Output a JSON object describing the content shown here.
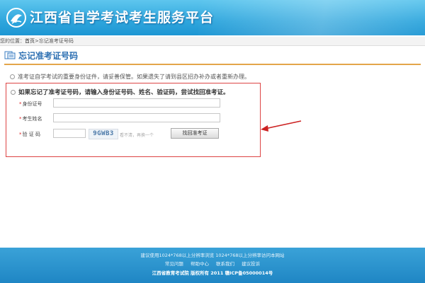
{
  "header": {
    "site_title": "江西省自学考试考生服务平台"
  },
  "breadcrumb": {
    "prefix": "您的位置：",
    "home": "首页",
    "separator": " > ",
    "current": "忘记准考证号码"
  },
  "page": {
    "title": "忘记准考证号码"
  },
  "notice": "准考证自学考试的重要身份证件，请妥善保管。如果遗失了请到县区招办补办或者重新办理。",
  "form": {
    "heading": "如果忘记了准考证号码，请输入身份证号码、姓名、验证码，尝试找回准考证。",
    "id_label": "身份证号",
    "name_label": "考生姓名",
    "captcha_label": "验 证 码",
    "id_value": "",
    "name_value": "",
    "captcha_value": "",
    "captcha_text": "9GWB3",
    "captcha_hint": "看不清，再换一个",
    "submit_label": "找回准考证"
  },
  "footer": {
    "line1": "建议使用1024*768以上分辨率浏览 1024*768以上分辨率访问本网站",
    "links": [
      "常见问题",
      "帮助中心",
      "联系我们",
      "建议投诉"
    ],
    "line3": "江西省教育考试院 版权所有 2011 赣ICP备05000014号"
  },
  "colors": {
    "header_blue": "#2fa6dd",
    "title_blue": "#2c6fb2",
    "rule_orange": "#e3a64a",
    "form_border_red": "#dd4444",
    "annotation_red": "#cc2222"
  }
}
